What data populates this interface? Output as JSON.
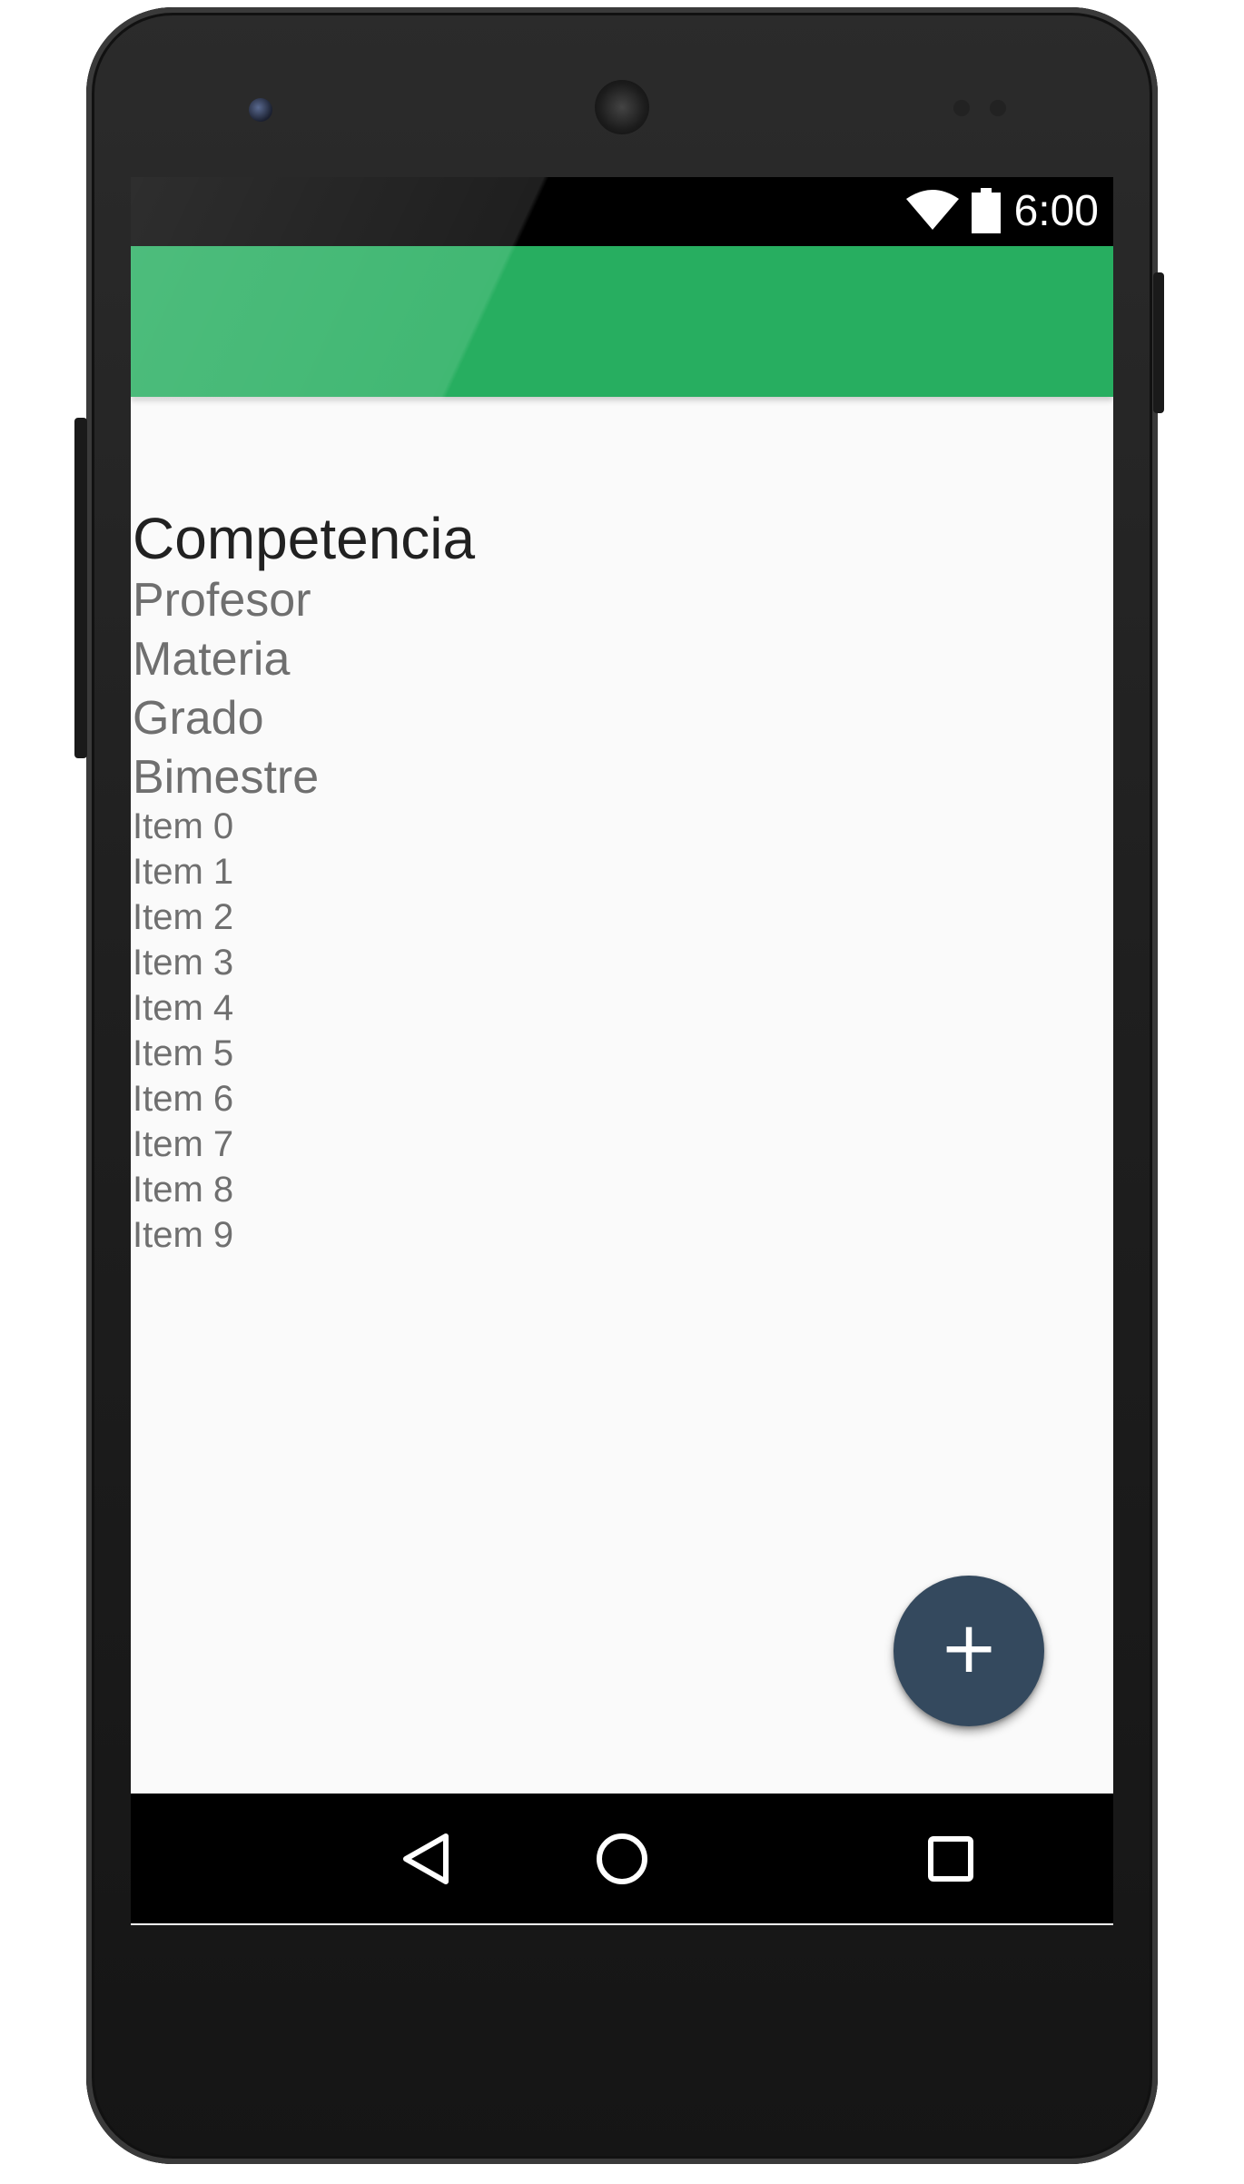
{
  "status_bar": {
    "time": "6:00",
    "wifi_icon": "wifi-icon",
    "battery_icon": "battery-icon"
  },
  "app_bar": {
    "color": "#27ae60"
  },
  "content": {
    "title": "Competencia",
    "subtitles": [
      "Profesor",
      "Materia",
      "Grado",
      "Bimestre"
    ],
    "items": [
      "Item 0",
      "Item 1",
      "Item 2",
      "Item 3",
      "Item 4",
      "Item 5",
      "Item 6",
      "Item 7",
      "Item 8",
      "Item 9"
    ]
  },
  "fab": {
    "label": "+",
    "icon": "plus-icon",
    "color": "#34495e"
  },
  "nav_bar": {
    "back_icon": "back-triangle-icon",
    "home_icon": "home-circle-icon",
    "recents_icon": "recents-square-icon"
  }
}
